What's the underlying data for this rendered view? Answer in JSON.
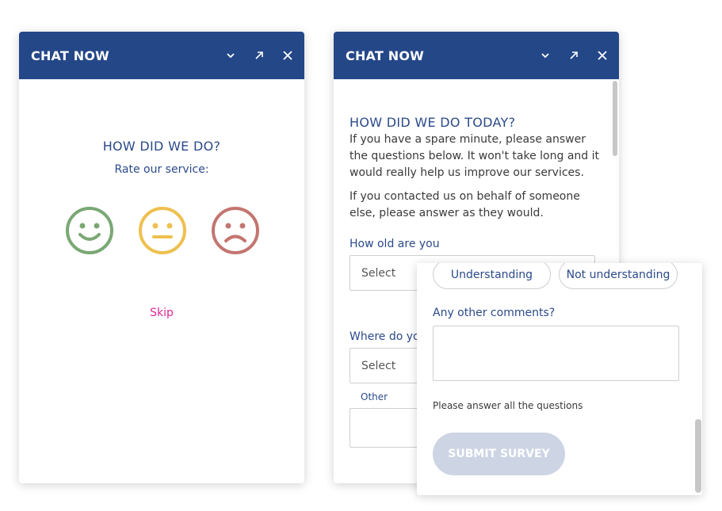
{
  "colors": {
    "header_bg": "#244788",
    "title_text": "#2b4a8b",
    "skip_link": "#e0289a",
    "face_happy": "#7aa874",
    "face_neutral": "#eec04f",
    "face_sad": "#c47570",
    "submit_bg": "#cdd4e4"
  },
  "widget1": {
    "header": {
      "title": "CHAT NOW",
      "minimize_icon": "chevron-down-icon",
      "popout_icon": "arrow-up-right-icon",
      "close_icon": "close-icon"
    },
    "question": "HOW DID WE DO?",
    "subtitle": "Rate our service:",
    "faces": [
      "smiley-happy-icon",
      "smiley-neutral-icon",
      "smiley-sad-icon"
    ],
    "skip": "Skip"
  },
  "widget2": {
    "header": {
      "title": "CHAT NOW"
    },
    "title": "HOW DID WE DO TODAY?",
    "intro": "If you have a spare minute, please answer the questions below. It won't take long and it would really help us improve our services.",
    "intro2": "If you contacted us on behalf of someone else, please answer as they would.",
    "age_label": "How old are you",
    "age_select": "Select",
    "where_label": "Where do you",
    "where_select": "Select",
    "other_label": "Other"
  },
  "widget3": {
    "options": [
      "Understanding",
      "Not understanding"
    ],
    "comments_label": "Any other comments?",
    "warning": "Please answer all the questions",
    "submit": "SUBMIT SURVEY"
  }
}
